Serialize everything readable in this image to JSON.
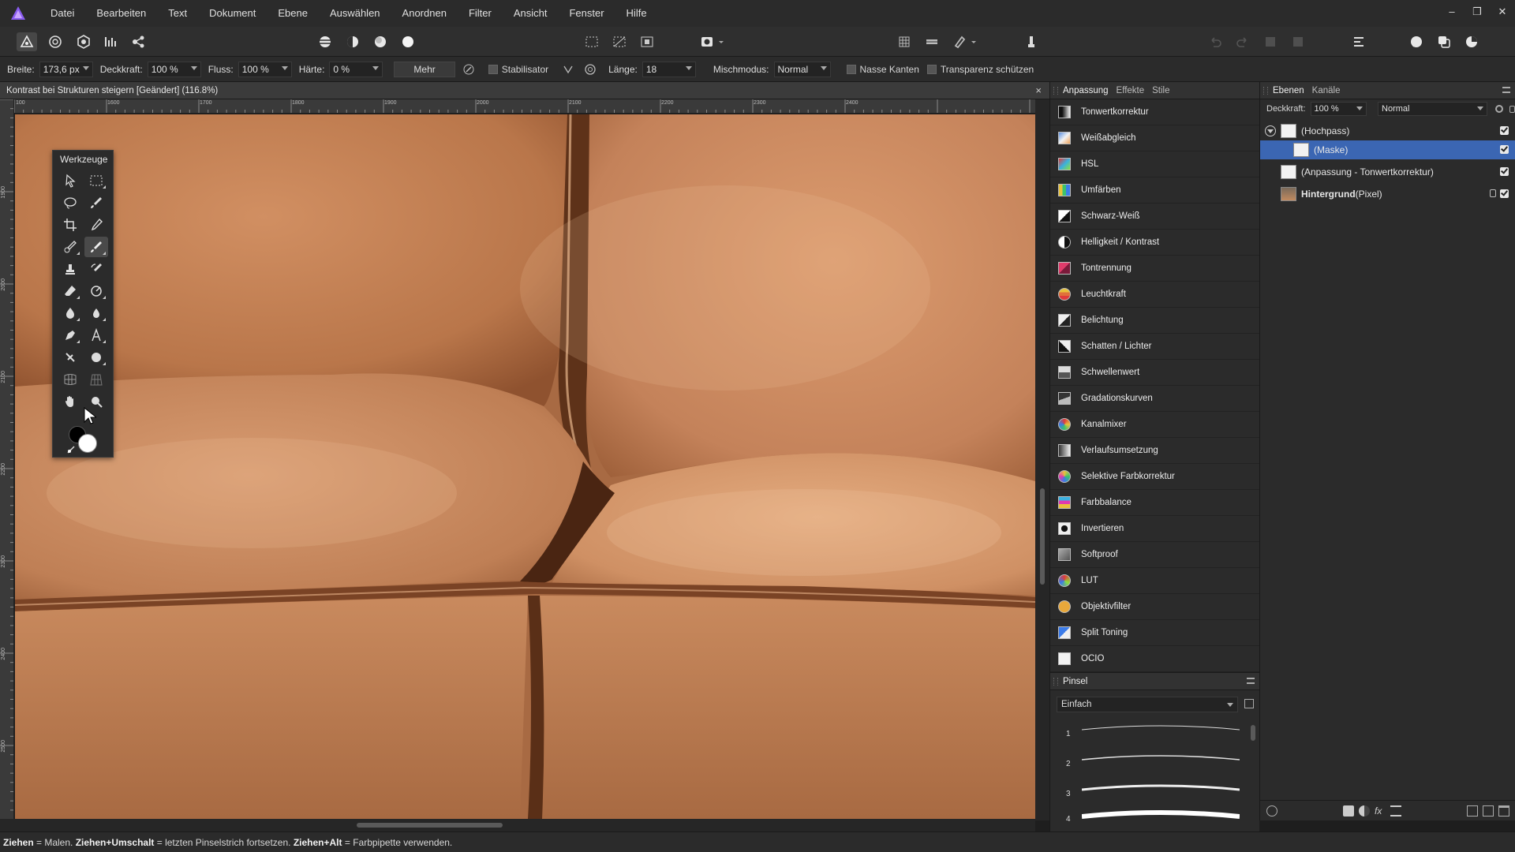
{
  "menubar": {
    "items": [
      "Datei",
      "Bearbeiten",
      "Text",
      "Dokument",
      "Ebene",
      "Auswählen",
      "Anordnen",
      "Filter",
      "Ansicht",
      "Fenster",
      "Hilfe"
    ],
    "window_controls": [
      "–",
      "❐",
      "✕"
    ]
  },
  "context": {
    "width_label": "Breite:",
    "width_value": "173,6 px",
    "opacity_label": "Deckkraft:",
    "opacity_value": "100 %",
    "flow_label": "Fluss:",
    "flow_value": "100 %",
    "hardness_label": "Härte:",
    "hardness_value": "0 %",
    "more_label": "Mehr",
    "stabilizer_label": "Stabilisator",
    "length_label": "Länge:",
    "length_value": "18",
    "blend_label": "Mischmodus:",
    "blend_value": "Normal",
    "wet_edges_label": "Nasse Kanten",
    "protect_alpha_label": "Transparenz schützen"
  },
  "document": {
    "tab_title": "Kontrast bei Strukturen steigern [Geändert] (116.8%)",
    "close": "×"
  },
  "rulers": {
    "top_ticks": [
      "100",
      "1600",
      "1700",
      "1800",
      "1900",
      "2000",
      "2100",
      "2200",
      "2300",
      "2400"
    ],
    "left_ticks": [
      "1900",
      "2000",
      "2100",
      "2200",
      "2300",
      "2400",
      "2500"
    ]
  },
  "tools_panel": {
    "title": "Werkzeuge"
  },
  "adjustments": {
    "tabs": [
      "Anpassung",
      "Effekte",
      "Stile"
    ],
    "items": [
      {
        "label": "Tonwertkorrektur"
      },
      {
        "label": "Weißabgleich"
      },
      {
        "label": "HSL"
      },
      {
        "label": "Umfärben"
      },
      {
        "label": "Schwarz-Weiß"
      },
      {
        "label": "Helligkeit / Kontrast"
      },
      {
        "label": "Tontrennung"
      },
      {
        "label": "Leuchtkraft"
      },
      {
        "label": "Belichtung"
      },
      {
        "label": "Schatten / Lichter"
      },
      {
        "label": "Schwellenwert"
      },
      {
        "label": "Gradationskurven"
      },
      {
        "label": "Kanalmixer"
      },
      {
        "label": "Verlaufsumsetzung"
      },
      {
        "label": "Selektive Farbkorrektur"
      },
      {
        "label": "Farbbalance"
      },
      {
        "label": "Invertieren"
      },
      {
        "label": "Softproof"
      },
      {
        "label": "LUT"
      },
      {
        "label": "Objektivfilter"
      },
      {
        "label": "Split Toning"
      },
      {
        "label": "OCIO"
      }
    ]
  },
  "layers": {
    "tabs": [
      "Ebenen",
      "Kanäle"
    ],
    "opacity_label": "Deckkraft:",
    "opacity_value": "100 %",
    "blend_value": "Normal",
    "rows": [
      {
        "name": "(Hochpass)",
        "extra": ""
      },
      {
        "name": "(Maske)",
        "extra": ""
      },
      {
        "name": "(Anpassung - Tonwertkorrektur)",
        "extra": ""
      },
      {
        "name": "Hintergrund",
        "extra": " (Pixel)"
      }
    ]
  },
  "brushes": {
    "tab": "Pinsel",
    "category": "Einfach",
    "sizes": [
      "1",
      "2",
      "3",
      "4"
    ]
  },
  "status": {
    "k1": "Ziehen",
    "t1": " = Malen. ",
    "k2": "Ziehen+Umschalt",
    "t2": " = letzten Pinselstrich fortsetzen. ",
    "k3": "Ziehen+Alt",
    "t3": " = Farbpipette verwenden."
  },
  "colors": {
    "accent": "#3b66b3",
    "leather": "#c07a4f",
    "panel": "#2b2b2b"
  }
}
